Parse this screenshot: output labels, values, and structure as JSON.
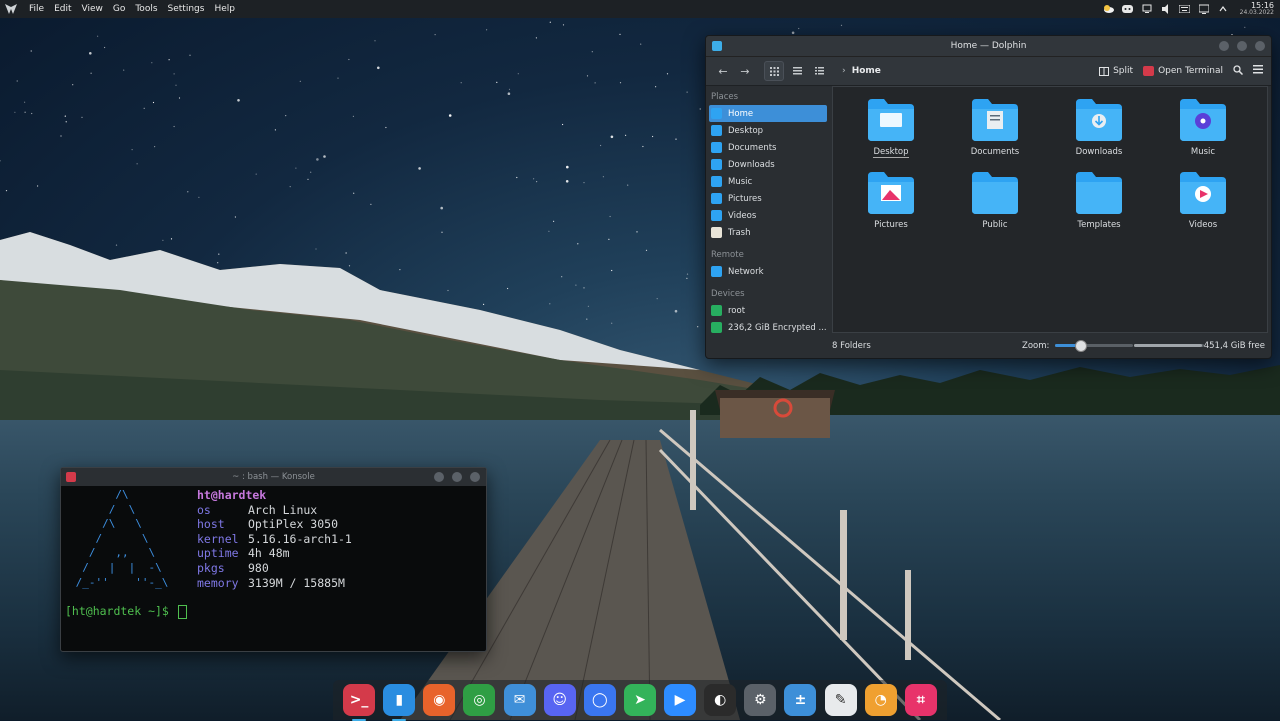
{
  "top_panel": {
    "menu": [
      "File",
      "Edit",
      "View",
      "Go",
      "Tools",
      "Settings",
      "Help"
    ],
    "tray_icons": [
      "weather-icon",
      "discord-icon",
      "network-icon",
      "volume-icon",
      "keyboard-icon",
      "display-icon",
      "expand-icon"
    ],
    "clock_time": "15:16",
    "clock_date": "24.03.2022"
  },
  "dolphin": {
    "title": "Home — Dolphin",
    "breadcrumb": "Home",
    "toolbar": {
      "split_label": "Split",
      "open_terminal_label": "Open Terminal"
    },
    "places_title": "Places",
    "places": [
      {
        "label": "Home",
        "selected": true
      },
      {
        "label": "Desktop"
      },
      {
        "label": "Documents"
      },
      {
        "label": "Downloads"
      },
      {
        "label": "Music"
      },
      {
        "label": "Pictures"
      },
      {
        "label": "Videos"
      },
      {
        "label": "Trash"
      }
    ],
    "remote_title": "Remote",
    "remote": [
      {
        "label": "Network"
      }
    ],
    "devices_title": "Devices",
    "devices": [
      {
        "label": "root"
      },
      {
        "label": "236,2 GiB Encrypted ..."
      }
    ],
    "folders": [
      {
        "label": "Desktop",
        "emblem": "desktop"
      },
      {
        "label": "Documents",
        "emblem": "documents"
      },
      {
        "label": "Downloads",
        "emblem": "downloads"
      },
      {
        "label": "Music",
        "emblem": "music"
      },
      {
        "label": "Pictures",
        "emblem": "pictures"
      },
      {
        "label": "Public",
        "emblem": "none"
      },
      {
        "label": "Templates",
        "emblem": "none"
      },
      {
        "label": "Videos",
        "emblem": "videos"
      }
    ],
    "status": {
      "count": "8 Folders",
      "zoom_label": "Zoom:",
      "zoom_level": 0.32,
      "free_space": "451,4 GiB free",
      "free_fraction": 0.97
    },
    "accent": "#3d8fd8",
    "folder_color": "#2ea3f2"
  },
  "konsole": {
    "title": "~ : bash — Konsole",
    "logo": "       /\\\n      /  \\\n     /\\   \\\n    /      \\\n   /   ,,   \\\n  /   |  |  -\\\n /_-''    ''-_\\",
    "user_host": "ht@hardtek",
    "info": [
      {
        "key": "os",
        "value": "Arch Linux"
      },
      {
        "key": "host",
        "value": "OptiPlex 3050"
      },
      {
        "key": "kernel",
        "value": "5.16.16-arch1-1"
      },
      {
        "key": "uptime",
        "value": "4h 48m"
      },
      {
        "key": "pkgs",
        "value": "980"
      },
      {
        "key": "memory",
        "value": "3139M / 15885M"
      }
    ],
    "prompt": "[ht@hardtek ~]$ "
  },
  "dock": [
    {
      "name": "konsole-icon",
      "color": "#d43a4a",
      "glyph": ">_",
      "active": true
    },
    {
      "name": "file-manager-icon",
      "color": "#2a8de0",
      "glyph": "▮",
      "active": true
    },
    {
      "name": "firefox-icon",
      "color": "#e8632b",
      "glyph": "◉"
    },
    {
      "name": "chrome-icon",
      "color": "#2f9e44",
      "glyph": "◎"
    },
    {
      "name": "mail-icon",
      "color": "#3f8fd8",
      "glyph": "✉"
    },
    {
      "name": "discord-icon",
      "color": "#5865f2",
      "glyph": "☺"
    },
    {
      "name": "signal-icon",
      "color": "#3a76f0",
      "glyph": "◯"
    },
    {
      "name": "telegram-icon",
      "color": "#33b35a",
      "glyph": "➤"
    },
    {
      "name": "zoom-icon",
      "color": "#2d8cff",
      "glyph": "▶"
    },
    {
      "name": "obs-icon",
      "color": "#2b2b2b",
      "glyph": "◐"
    },
    {
      "name": "settings-icon",
      "color": "#5b6168",
      "glyph": "⚙"
    },
    {
      "name": "calculator-icon",
      "color": "#3d8fd8",
      "glyph": "±"
    },
    {
      "name": "text-editor-icon",
      "color": "#e8eaec",
      "glyph": "✎"
    },
    {
      "name": "app-icon",
      "color": "#f0a030",
      "glyph": "◔"
    },
    {
      "name": "screenshot-icon",
      "color": "#e8336a",
      "glyph": "⌗"
    }
  ]
}
